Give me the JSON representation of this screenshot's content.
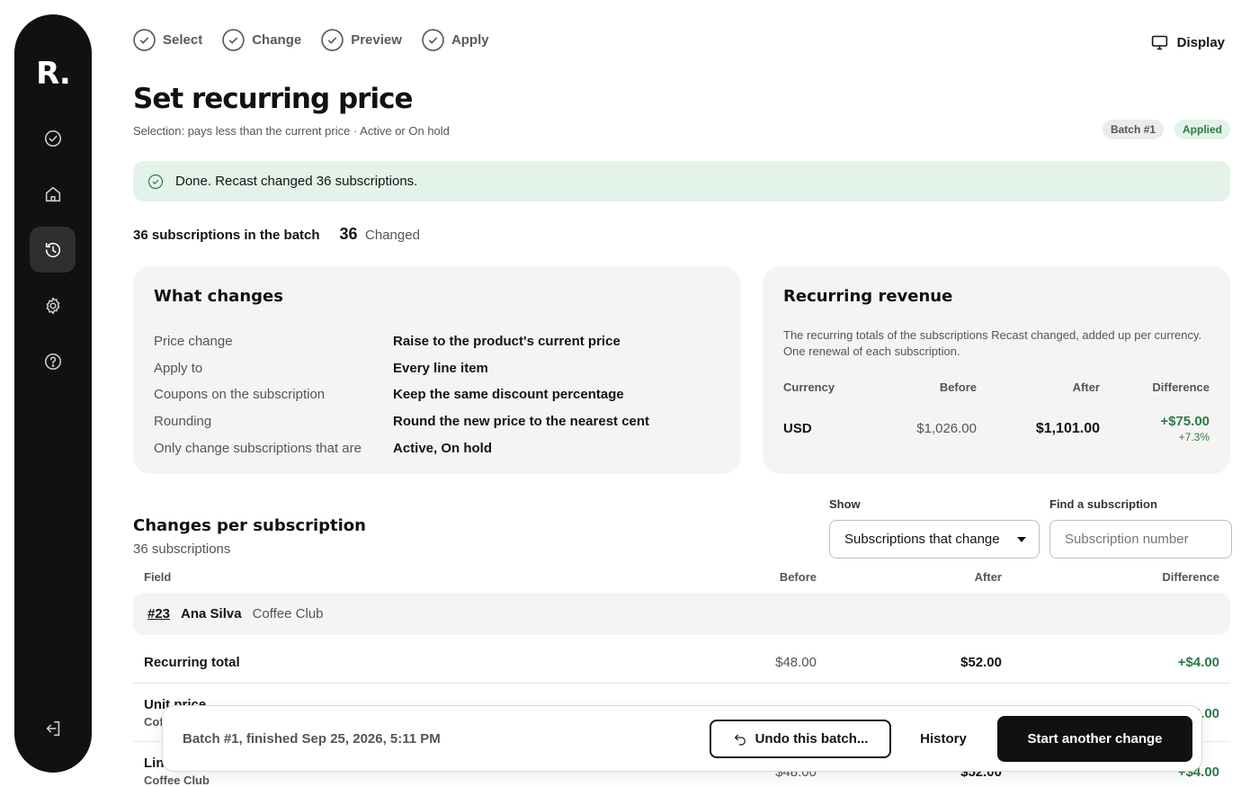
{
  "sidebar": {
    "logo": "R.",
    "items": [
      {
        "icon": "check-circle-icon"
      },
      {
        "icon": "home-icon"
      },
      {
        "icon": "history-icon",
        "active": true
      },
      {
        "icon": "gear-icon"
      },
      {
        "icon": "help-icon"
      }
    ],
    "logout_icon": "logout-icon"
  },
  "stepper": {
    "steps": [
      "Select",
      "Change",
      "Preview",
      "Apply"
    ]
  },
  "header": {
    "display_label": "Display",
    "title": "Set recurring price",
    "subtitle": "Selection: pays less than the current price · Active or On hold",
    "badges": {
      "batch": "Batch #1",
      "status": "Applied"
    }
  },
  "alert": {
    "message": "Done. Recast changed 36 subscriptions."
  },
  "summary": {
    "total_text": "36 subscriptions in the batch",
    "changed_count": "36",
    "changed_label": "Changed"
  },
  "what_changes": {
    "title": "What changes",
    "rows": [
      {
        "key": "Price change",
        "value": "Raise to the product's current price"
      },
      {
        "key": "Apply to",
        "value": "Every line item"
      },
      {
        "key": "Coupons on the subscription",
        "value": "Keep the same discount percentage"
      },
      {
        "key": "Rounding",
        "value": "Round the new price to the nearest cent"
      },
      {
        "key": "Only change subscriptions that are",
        "value": "Active, On hold"
      }
    ]
  },
  "recurring_revenue": {
    "title": "Recurring revenue",
    "description": "The recurring totals of the subscriptions Recast changed, added up per currency. One renewal of each subscription.",
    "headers": [
      "Currency",
      "Before",
      "After",
      "Difference"
    ],
    "rows": [
      {
        "currency": "USD",
        "before": "$1,026.00",
        "after": "$1,101.00",
        "difference": "+$75.00",
        "percent": "+7.3%"
      }
    ]
  },
  "changes_section": {
    "title": "Changes per subscription",
    "subtitle": "36 subscriptions",
    "show_label": "Show",
    "show_value": "Subscriptions that change",
    "find_label": "Find a subscription",
    "find_placeholder": "Subscription number",
    "headers": {
      "field": "Field",
      "before": "Before",
      "after": "After",
      "difference": "Difference"
    },
    "group": {
      "number": "#23",
      "name": "Ana Silva",
      "product": "Coffee Club"
    },
    "rows": [
      {
        "field": "Recurring total",
        "sub": "",
        "before": "$48.00",
        "after": "$52.00",
        "difference": "+$4.00"
      },
      {
        "field": "Unit price",
        "sub": "Coffee Club",
        "before": "",
        "after": "",
        "difference": "+$4.00"
      },
      {
        "field": "Line total",
        "sub": "Coffee Club",
        "before": "$48.00",
        "after": "$52.00",
        "difference": "+$4.00"
      }
    ]
  },
  "bottom_bar": {
    "status": "Batch #1, finished Sep 25, 2026, 5:11 PM",
    "undo_label": "Undo this batch...",
    "history_label": "History",
    "start_label": "Start another change"
  }
}
